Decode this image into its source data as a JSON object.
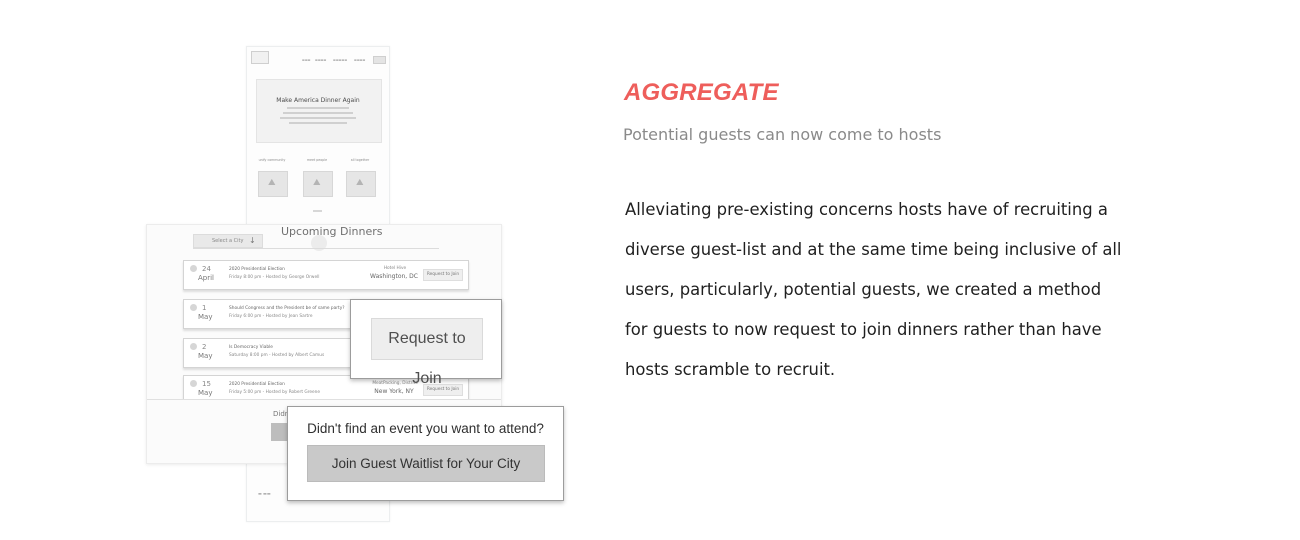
{
  "section": {
    "heading": "AGGREGATE",
    "subheading": "Potential guests can now come to hosts",
    "body_lines": [
      "Alleviating pre-existing concerns hosts have of recruiting a",
      "diverse guest-list and at the same time being inclusive of all",
      "users, particularly, potential guests, we created a method",
      "for guests to now request to join dinners rather than have",
      "hosts scramble to recruit."
    ],
    "accent_color": "#ee5e5b"
  },
  "wireframe": {
    "hero_title": "Make America Dinner Again",
    "columns": [
      "unify community",
      "meet people",
      "all together"
    ],
    "image_icon": "image-placeholder-icon",
    "dinners": {
      "title": "Upcoming Dinners",
      "city_select": "Select a City",
      "events": [
        {
          "day": "24",
          "month": "April",
          "title": "2020 Presidential Election",
          "subtitle": "Friday 8:00 pm - Hosted by George Orwell",
          "venue": "Hotel Hive",
          "city": "Washington, DC",
          "button": "Request to Join"
        },
        {
          "day": "1",
          "month": "May",
          "title": "Should Congress and the President be of same party?",
          "subtitle": "Friday 6:00 pm - Hosted by Jean Sartre",
          "venue": "",
          "city": "",
          "button": ""
        },
        {
          "day": "2",
          "month": "May",
          "title": "Is Democracy Viable",
          "subtitle": "Saturday 8:00 pm - Hosted by Albert Camus",
          "venue": "",
          "city": "",
          "button": ""
        },
        {
          "day": "15",
          "month": "May",
          "title": "2020 Presidential Election",
          "subtitle": "Friday 5:00 pm - Hosted by Robert Greene",
          "venue": "MeatPacking, District",
          "city": "New York, NY",
          "button": "Request to Join"
        }
      ],
      "ghost_text": "Didn"
    }
  },
  "callouts": {
    "request_to_join": "Request to Join",
    "waitlist_question": "Didn't find an event you want to attend?",
    "waitlist_button": "Join Guest Waitlist for Your City"
  }
}
